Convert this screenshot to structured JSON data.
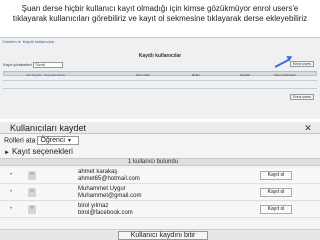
{
  "caption": "Şuan derse hiçbir kullanıcı kayıt olmadığı için kimse gözükmüyor enrol users'e tıklayarak kullanıcıları görebiliriz ve kayıt ol sekmesine tıklayarak derse ekleyebiliriz",
  "top": {
    "breadcrumb": [
      "Yönetim",
      "Kayıtlı kullanıcılar"
    ],
    "panel_title": "Kayıtlı kullanıcılar",
    "role_label": "Kayıt yöntemleri",
    "role_value": "Tümü",
    "enrol_button": "Enrol users",
    "pager": "Ad / Soyad ↓ / E-posta adresi",
    "columns": [
      "Son erişim",
      "Roller",
      "Gruplar",
      "Kayıt yöntemleri"
    ]
  },
  "dialog": {
    "title": "Kullanıcıları kaydet",
    "role_label": "Rolleri ata",
    "role_value": "Öğrenci",
    "options_label": "Kayıt seçenekleri",
    "list_header": "1 kullanıcı bulundu",
    "users": [
      {
        "name": "ahmet karakaş",
        "email": "ahmet65@hotmail.com",
        "action": "Kayıt ol"
      },
      {
        "name": "Muhammet Uygur",
        "email": "Muhammet@gmail.com",
        "action": "Kayıt ol"
      },
      {
        "name": "birol yılmaz",
        "email": "birol@facebook.com",
        "action": "Kayıt ol"
      }
    ],
    "finish_button": "Kullanıcı kaydını bitir",
    "close_symbol": "✕"
  },
  "colors": {
    "arrow": "#3a6fd8",
    "link": "#3a5a8c"
  }
}
